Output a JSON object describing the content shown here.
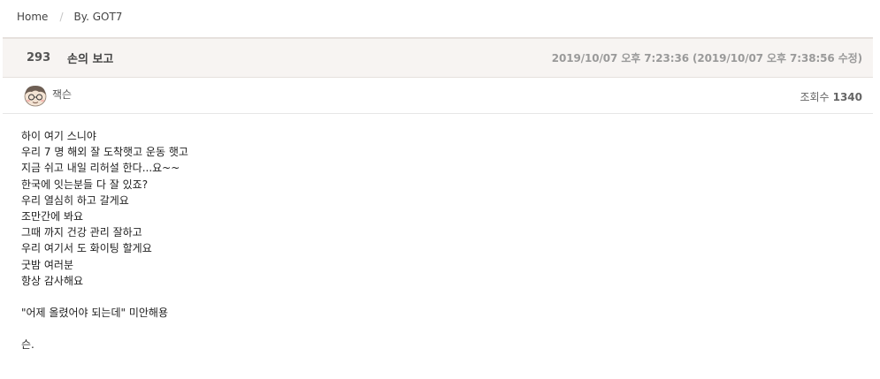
{
  "breadcrumb": {
    "home": "Home",
    "separator": "/",
    "current": "By. GOT7"
  },
  "post": {
    "number": "293",
    "title": "손의 보고",
    "date": "2019/10/07 오후 7:23:36 (2019/10/07 오후 7:38:56 수정)",
    "author": "잭슨",
    "views_label": "조회수",
    "views": "1340",
    "body": {
      "line1": "하이 여기 스니야",
      "line2": "우리 7 명 해외 잘 도착햇고 운동 햇고",
      "line3": "지금 쉬고 내일 리허설 한다...요~~",
      "line4": "한국에 잇는분들 다 잘 있죠?",
      "line5": "우리 열심히 하고 갈게요",
      "line6": "조만간에 봐요",
      "line7": "그때 까지 건강 관리 잘하고",
      "line8": "우리 여기서 도 화이팅 할게요",
      "line9": "굿밤 여러분",
      "line10": "항상 감사해요",
      "line11": "\"어제 올렸어야 되는데\" 미안해용",
      "line12": "슨."
    }
  },
  "icons": {
    "avatar": "avatar-face-icon"
  },
  "colors": {
    "header_bg": "#f7f4f2",
    "border": "#e6e1dd",
    "date_text": "#9a9a9a"
  }
}
